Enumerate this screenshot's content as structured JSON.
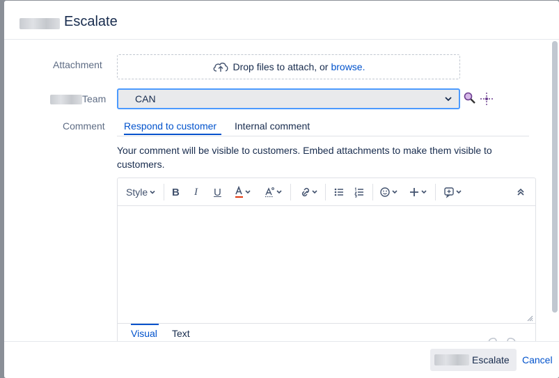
{
  "dialog": {
    "title": "Escalate"
  },
  "attachment": {
    "label": "Attachment",
    "drop_text": "Drop files to attach, or",
    "browse_link": "browse."
  },
  "team": {
    "label": "Team",
    "selected": "CAN"
  },
  "comment": {
    "label": "Comment",
    "tabs": [
      "Respond to customer",
      "Internal comment"
    ],
    "active_tab": "Respond to customer",
    "hint": "Your comment will be visible to customers. Embed attachments to make them visible to customers.",
    "value": ""
  },
  "toolbar": {
    "style_label": "Style",
    "icons": [
      "bold-icon",
      "italic-icon",
      "underline-icon",
      "text-color-icon",
      "text-format-icon",
      "link-icon",
      "bullet-list-icon",
      "numbered-list-icon",
      "emoji-icon",
      "insert-icon",
      "macro-icon",
      "collapse-icon"
    ],
    "text_color": "#de350b"
  },
  "editor_modes": {
    "visual": "Visual",
    "text": "Text",
    "active": "Visual"
  },
  "footer": {
    "escalate_label": "Escalate",
    "cancel_label": "Cancel"
  },
  "colors": {
    "accent": "#0052cc",
    "focus": "#4c9aff",
    "text": "#172b4d",
    "subtle": "#5e6c84"
  }
}
